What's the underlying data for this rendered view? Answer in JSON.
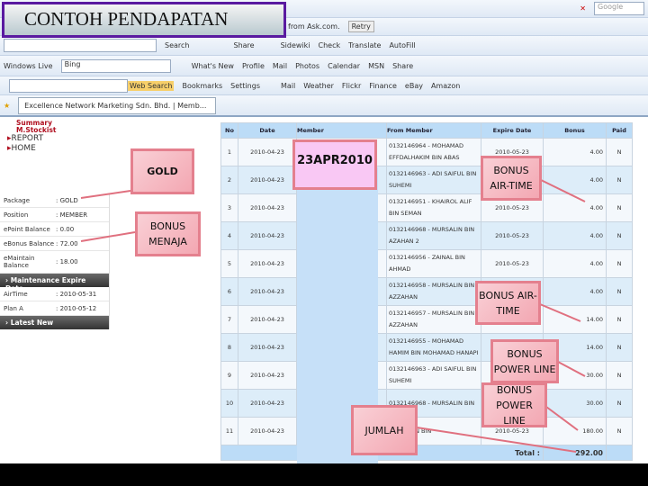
{
  "slide_title": "CONTOH PENDAPATAN",
  "browser": {
    "google_box": "Google",
    "ask_text": "from Ask.com.",
    "retry": "Retry",
    "toolbar1": [
      "Search",
      "Share",
      "Sidewiki",
      "Check",
      "Translate",
      "AutoFill"
    ],
    "windows_live": "Windows Live",
    "bing": "Bing",
    "toolbar2": [
      "What's New",
      "Profile",
      "Mail",
      "Photos",
      "Calendar",
      "MSN",
      "Share"
    ],
    "web_search": "Web Search",
    "toolbar3": [
      "Bookmarks",
      "Settings",
      "Mail",
      "Weather",
      "Flickr",
      "Finance",
      "eBay",
      "Amazon"
    ],
    "tab": "Excellence Network Marketing Sdn. Bhd. | Memb..."
  },
  "sidebar": {
    "links": [
      "Summary",
      "M.Stockist"
    ],
    "nav": [
      "REPORT",
      "HOME"
    ],
    "info": [
      {
        "label": "Package",
        "value": ": GOLD"
      },
      {
        "label": "Position",
        "value": ": MEMBER"
      },
      {
        "label": "ePoint Balance",
        "value": ": 0.00"
      },
      {
        "label": "eBonus Balance",
        "value": ": 72.00"
      },
      {
        "label": "eMaintain Balance",
        "value": ": 18.00"
      }
    ],
    "maint_header": "Maintenance Expire Date",
    "maint": [
      {
        "label": "AirTime",
        "value": ": 2010-05-31"
      },
      {
        "label": "Plan A",
        "value": ": 2010-05-12"
      }
    ],
    "latest_header": "Latest New"
  },
  "table": {
    "headers": [
      "No",
      "Date",
      "Member",
      "From Member",
      "Expire Date",
      "Bonus",
      "Paid"
    ],
    "rows": [
      [
        "1",
        "2010-04-23",
        "",
        "0132146964 - MOHAMAD EFFDALHAKIM BIN ABAS",
        "2010-05-23",
        "4.00",
        "N"
      ],
      [
        "2",
        "2010-04-23",
        "",
        "0132146963 - ADI SAIFUL BIN SUHEMI",
        "",
        "4.00",
        "N"
      ],
      [
        "3",
        "2010-04-23",
        "",
        "0132146951 - KHAIROL ALIF BIN SEMAN",
        "2010-05-23",
        "4.00",
        "N"
      ],
      [
        "4",
        "2010-04-23",
        "",
        "0132146968 - MURSALIN BIN AZAHAN 2",
        "2010-05-23",
        "4.00",
        "N"
      ],
      [
        "5",
        "2010-04-23",
        "",
        "0132146956 - ZAINAL BIN AHMAD",
        "2010-05-23",
        "4.00",
        "N"
      ],
      [
        "6",
        "2010-04-23",
        "",
        "0132146958 - MURSALIN BIN AZZAHAN",
        "",
        "4.00",
        "N"
      ],
      [
        "7",
        "2010-04-23",
        "",
        "0132146957 - MURSALIN BIN AZZAHAN",
        "",
        "14.00",
        "N"
      ],
      [
        "8",
        "2010-04-23",
        "",
        "0132146955 - MOHAMAD HAMIM BIN MOHAMAD HANAPI",
        "",
        "14.00",
        "N"
      ],
      [
        "9",
        "2010-04-23",
        "",
        "0132146963 - ADI SAIFUL BIN SUHEMI",
        "",
        "30.00",
        "N"
      ],
      [
        "10",
        "2010-04-23",
        "",
        "0132146968 - MURSALIN BIN",
        "",
        "30.00",
        "N"
      ],
      [
        "11",
        "2010-04-23",
        "",
        "MURSALIN BIN",
        "2010-05-23",
        "180.00",
        "N"
      ]
    ],
    "total_label": "Total :",
    "total": "292.00"
  },
  "callouts": {
    "gold": "GOLD",
    "menaja": "BONUS MENAJA",
    "date": "23APR2010",
    "airtime1": "BONUS AIR-TIME",
    "airtime2": "BONUS AIR-TIME",
    "power1": "BONUS POWER LINE",
    "power2": "BONUS POWER LINE",
    "jumlah": "JUMLAH"
  }
}
